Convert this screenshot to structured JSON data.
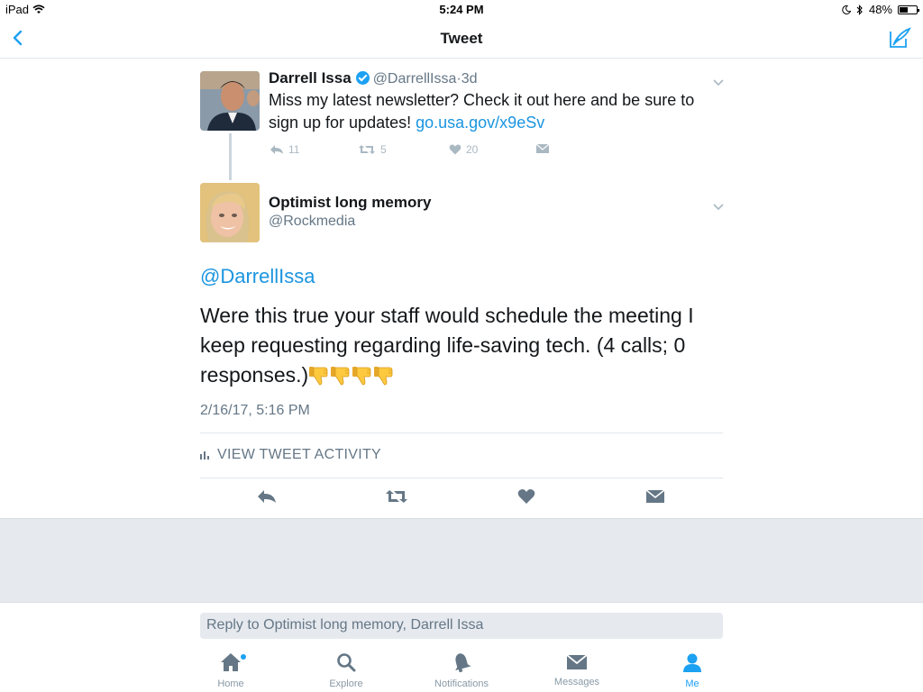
{
  "status_bar": {
    "device": "iPad",
    "time": "5:24 PM",
    "battery": "48%",
    "battery_level": 0.48
  },
  "nav": {
    "title": "Tweet"
  },
  "parent_tweet": {
    "name": "Darrell Issa",
    "handle": "@DarrellIssa",
    "separator": "·",
    "age": "3d",
    "text": "Miss my latest newsletter? Check it out here and be sure to sign up for updates! ",
    "link": "go.usa.gov/x9eSv",
    "reply_count": "11",
    "retweet_count": "5",
    "like_count": "20"
  },
  "main_tweet": {
    "name": "Optimist long memory",
    "handle": "@Rockmedia",
    "mention": "@DarrellIssa",
    "text": "Were this true your staff would schedule the meeting I keep requesting regarding life-saving tech. (4 calls; 0 responses.)",
    "emoji_count": 4,
    "timestamp": "2/16/17, 5:16 PM",
    "view_activity": "VIEW TWEET ACTIVITY"
  },
  "reply": {
    "placeholder": "Reply to Optimist long memory, Darrell Issa"
  },
  "tabs": [
    {
      "label": "Home",
      "icon": "home-icon"
    },
    {
      "label": "Explore",
      "icon": "search-icon"
    },
    {
      "label": "Notifications",
      "icon": "bell-icon"
    },
    {
      "label": "Messages",
      "icon": "envelope-icon"
    },
    {
      "label": "Me",
      "icon": "person-icon",
      "active": true
    }
  ],
  "colors": {
    "accent": "#1da1f2",
    "link": "#1b95e0",
    "muted": "#657786"
  }
}
